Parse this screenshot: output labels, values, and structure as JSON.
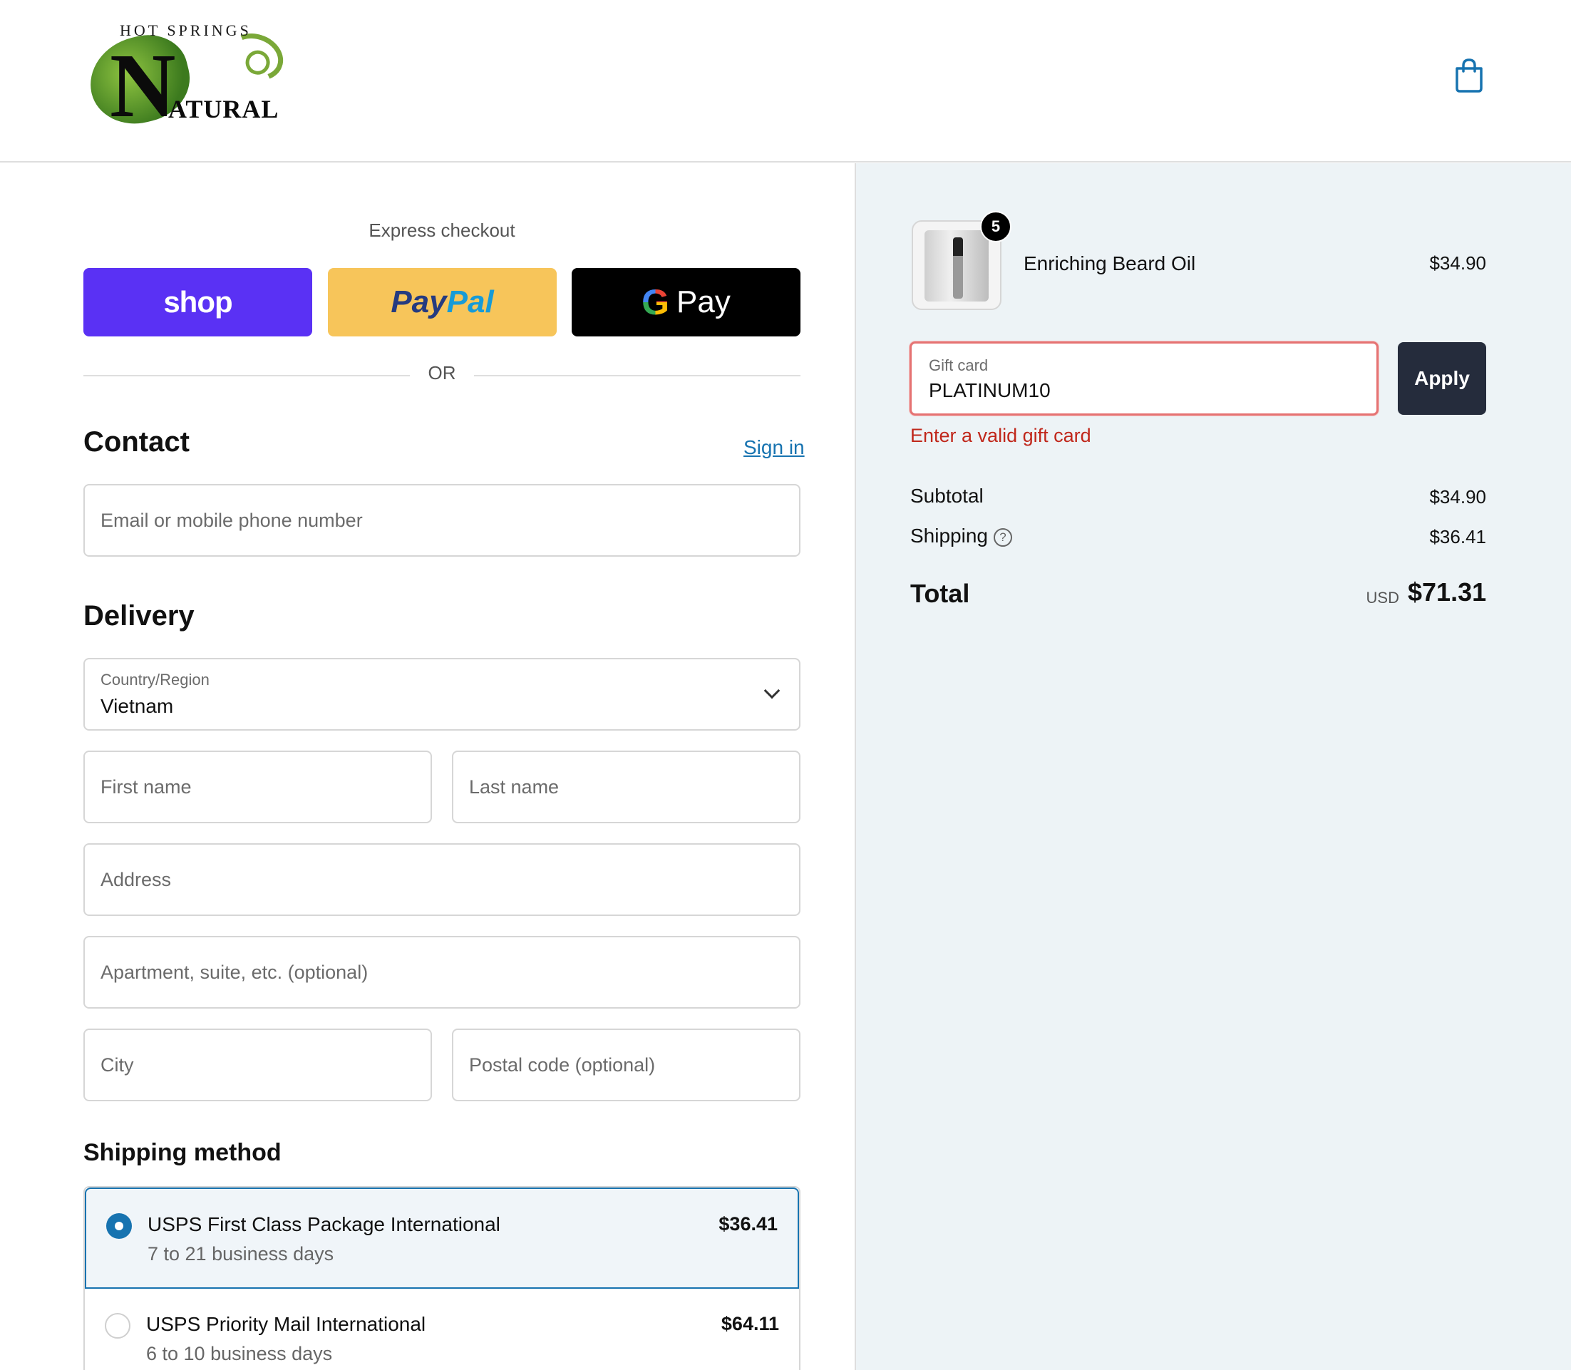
{
  "header": {
    "logo_arc": "HOT SPRINGS",
    "logo_letter": "N",
    "logo_rest": "ATURAL",
    "cart_icon": "shopping-bag-icon"
  },
  "express": {
    "label": "Express checkout",
    "shop_label": "shop",
    "paypal_part1": "Pay",
    "paypal_part2": "Pal",
    "gpay_g": "G",
    "gpay_label": "Pay",
    "or_label": "OR"
  },
  "contact": {
    "heading": "Contact",
    "sign_in": "Sign in",
    "email_placeholder": "Email or mobile phone number"
  },
  "delivery": {
    "heading": "Delivery",
    "country_label": "Country/Region",
    "country_value": "Vietnam",
    "first_name_placeholder": "First name",
    "last_name_placeholder": "Last name",
    "address_placeholder": "Address",
    "apartment_placeholder": "Apartment, suite, etc. (optional)",
    "city_placeholder": "City",
    "postal_placeholder": "Postal code (optional)"
  },
  "shipping": {
    "heading": "Shipping method",
    "options": [
      {
        "name": "USPS First Class Package International",
        "days": "7 to 21 business days",
        "price": "$36.41",
        "selected": true
      },
      {
        "name": "USPS Priority Mail International",
        "days": "6 to 10 business days",
        "price": "$64.11",
        "selected": false
      }
    ]
  },
  "summary": {
    "product": {
      "name": "Enriching Beard Oil",
      "price": "$34.90",
      "quantity": "5"
    },
    "gift_card": {
      "label": "Gift card",
      "value": "PLATINUM10",
      "apply_label": "Apply",
      "error": "Enter a valid gift card"
    },
    "subtotal_label": "Subtotal",
    "subtotal_value": "$34.90",
    "shipping_label": "Shipping",
    "shipping_value": "$36.41",
    "help_glyph": "?",
    "total_label": "Total",
    "currency": "USD",
    "total_value": "$71.31"
  },
  "colors": {
    "shop_purple": "#5a31f4",
    "paypal_yellow": "#f7c55a",
    "link_blue": "#1773b0",
    "error_red": "#c0271b",
    "apply_navy": "#252c3c",
    "summary_bg": "#edf3f6"
  }
}
